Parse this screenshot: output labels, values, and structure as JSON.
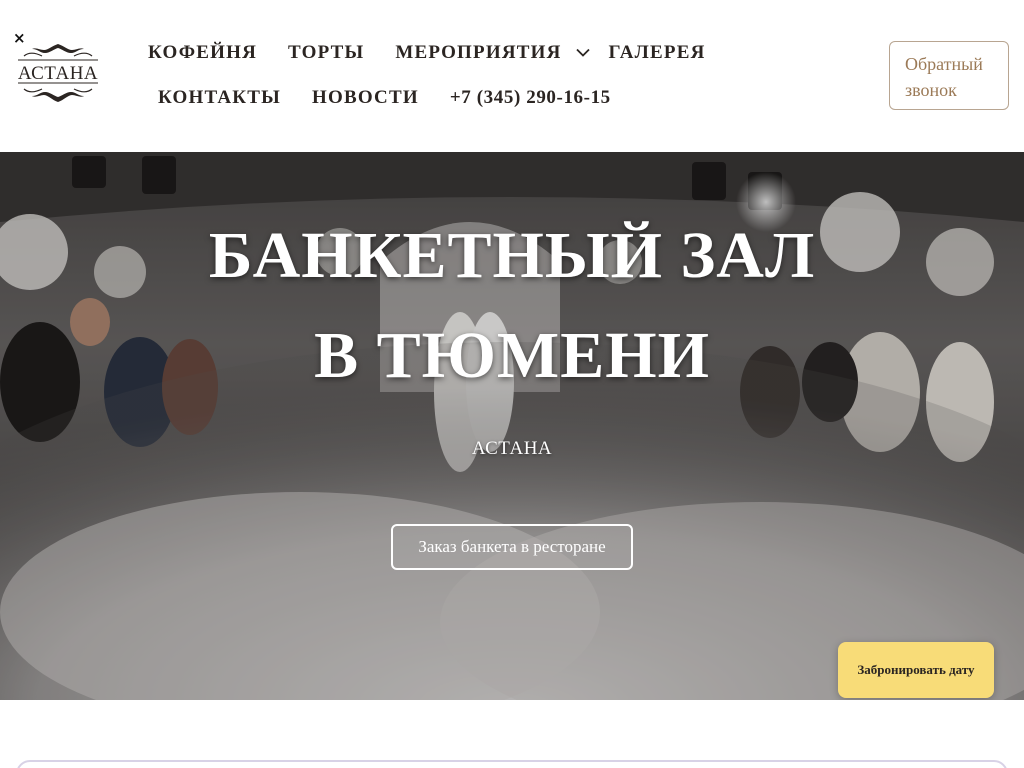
{
  "header": {
    "close_symbol": "×",
    "logo_text": "АСТАНА",
    "nav_row1": [
      "КОФЕЙНЯ",
      "ТОРТЫ",
      "МЕРОПРИЯТИЯ",
      "ГАЛЕРЕЯ"
    ],
    "nav_row2": [
      "КОНТАКТЫ",
      "НОВОСТИ"
    ],
    "phone": "+7 (345) 290-16-15",
    "callback_line1": "Обратный",
    "callback_line2": "звонок"
  },
  "hero": {
    "title_line1": "БАНКЕТНЫЙ ЗАЛ",
    "title_line2": "В ТЮМЕНИ",
    "subtitle": "АСТАНА",
    "cta_label": "Заказ банкета в ресторане",
    "book_label": "Забронировать дату"
  },
  "colors": {
    "accent": "#9b7a57",
    "book_button": "#f8dc78",
    "text": "#2b2522"
  },
  "icons": {
    "close": "close-icon",
    "dropdown": "chevron-down-icon"
  }
}
